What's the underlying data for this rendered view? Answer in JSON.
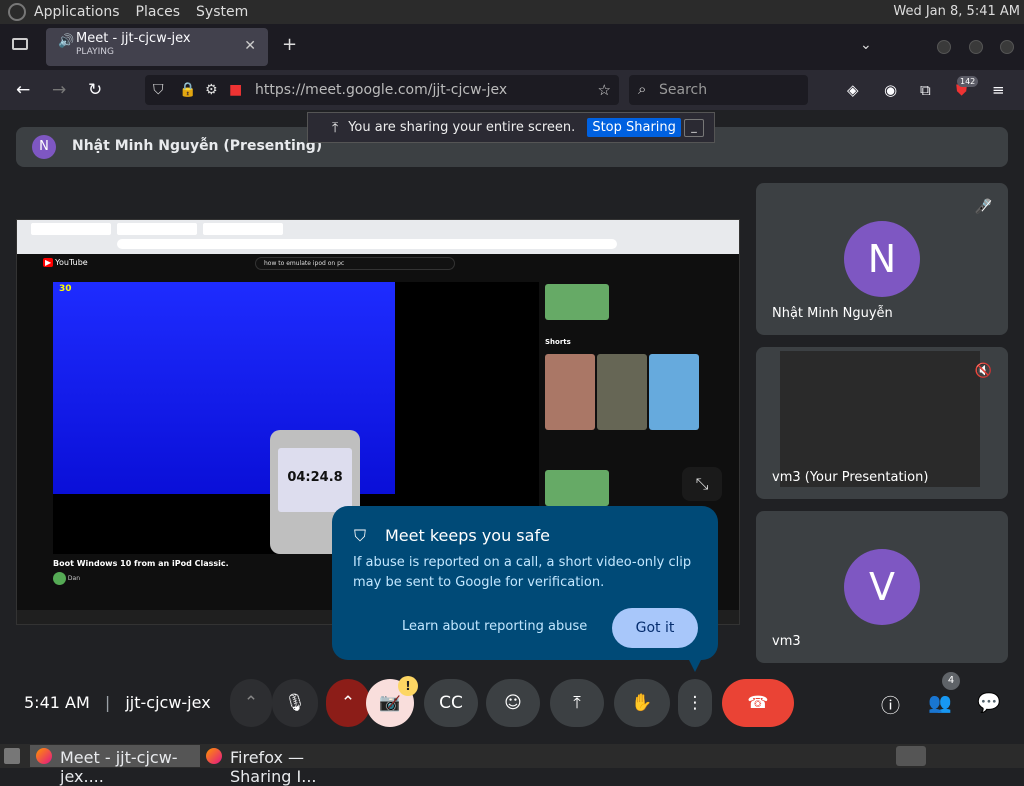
{
  "desktop": {
    "menus": [
      "Applications",
      "Places",
      "System"
    ],
    "clock": "Wed Jan  8,  5:41 AM"
  },
  "browser": {
    "tab_title": "Meet - jjt-cjcw-jex",
    "tab_status": "PLAYING",
    "url": "https://meet.google.com/jjt-cjcw-jex",
    "search_placeholder": "Search",
    "extension_badge": "142"
  },
  "share_bar": {
    "message": "You are sharing your entire screen.",
    "stop_label": "Stop Sharing"
  },
  "meet": {
    "presenter_initial": "N",
    "presenter_label": "Nhật Minh Nguyễn (Presenting)",
    "shared": {
      "search_query": "how to emulate ipod on pc",
      "video_time": "04:24.8",
      "video_badge": "30",
      "video_title": "Boot Windows 10 from an iPod Classic.",
      "channel": "Dan",
      "shorts_label": "Shorts",
      "yt_logo": "YouTube"
    },
    "tiles": [
      {
        "initial": "N",
        "name": "Nhật Minh Nguyễn"
      },
      {
        "name": "vm3 (Your Presentation)"
      },
      {
        "initial": "V",
        "name": "vm3"
      }
    ],
    "popup": {
      "title": "Meet keeps you safe",
      "body": "If abuse is reported on a call, a short video-only clip may be sent to Google for verification.",
      "learn_label": "Learn about reporting abuse",
      "got_it_label": "Got it"
    },
    "time": "5:41 AM",
    "meeting_code": "jjt-cjcw-jex",
    "participant_count": "4",
    "warn_mark": "!"
  },
  "taskbar": {
    "items": [
      "Meet - jjt-cjcw-jex....",
      "Firefox — Sharing I..."
    ]
  }
}
